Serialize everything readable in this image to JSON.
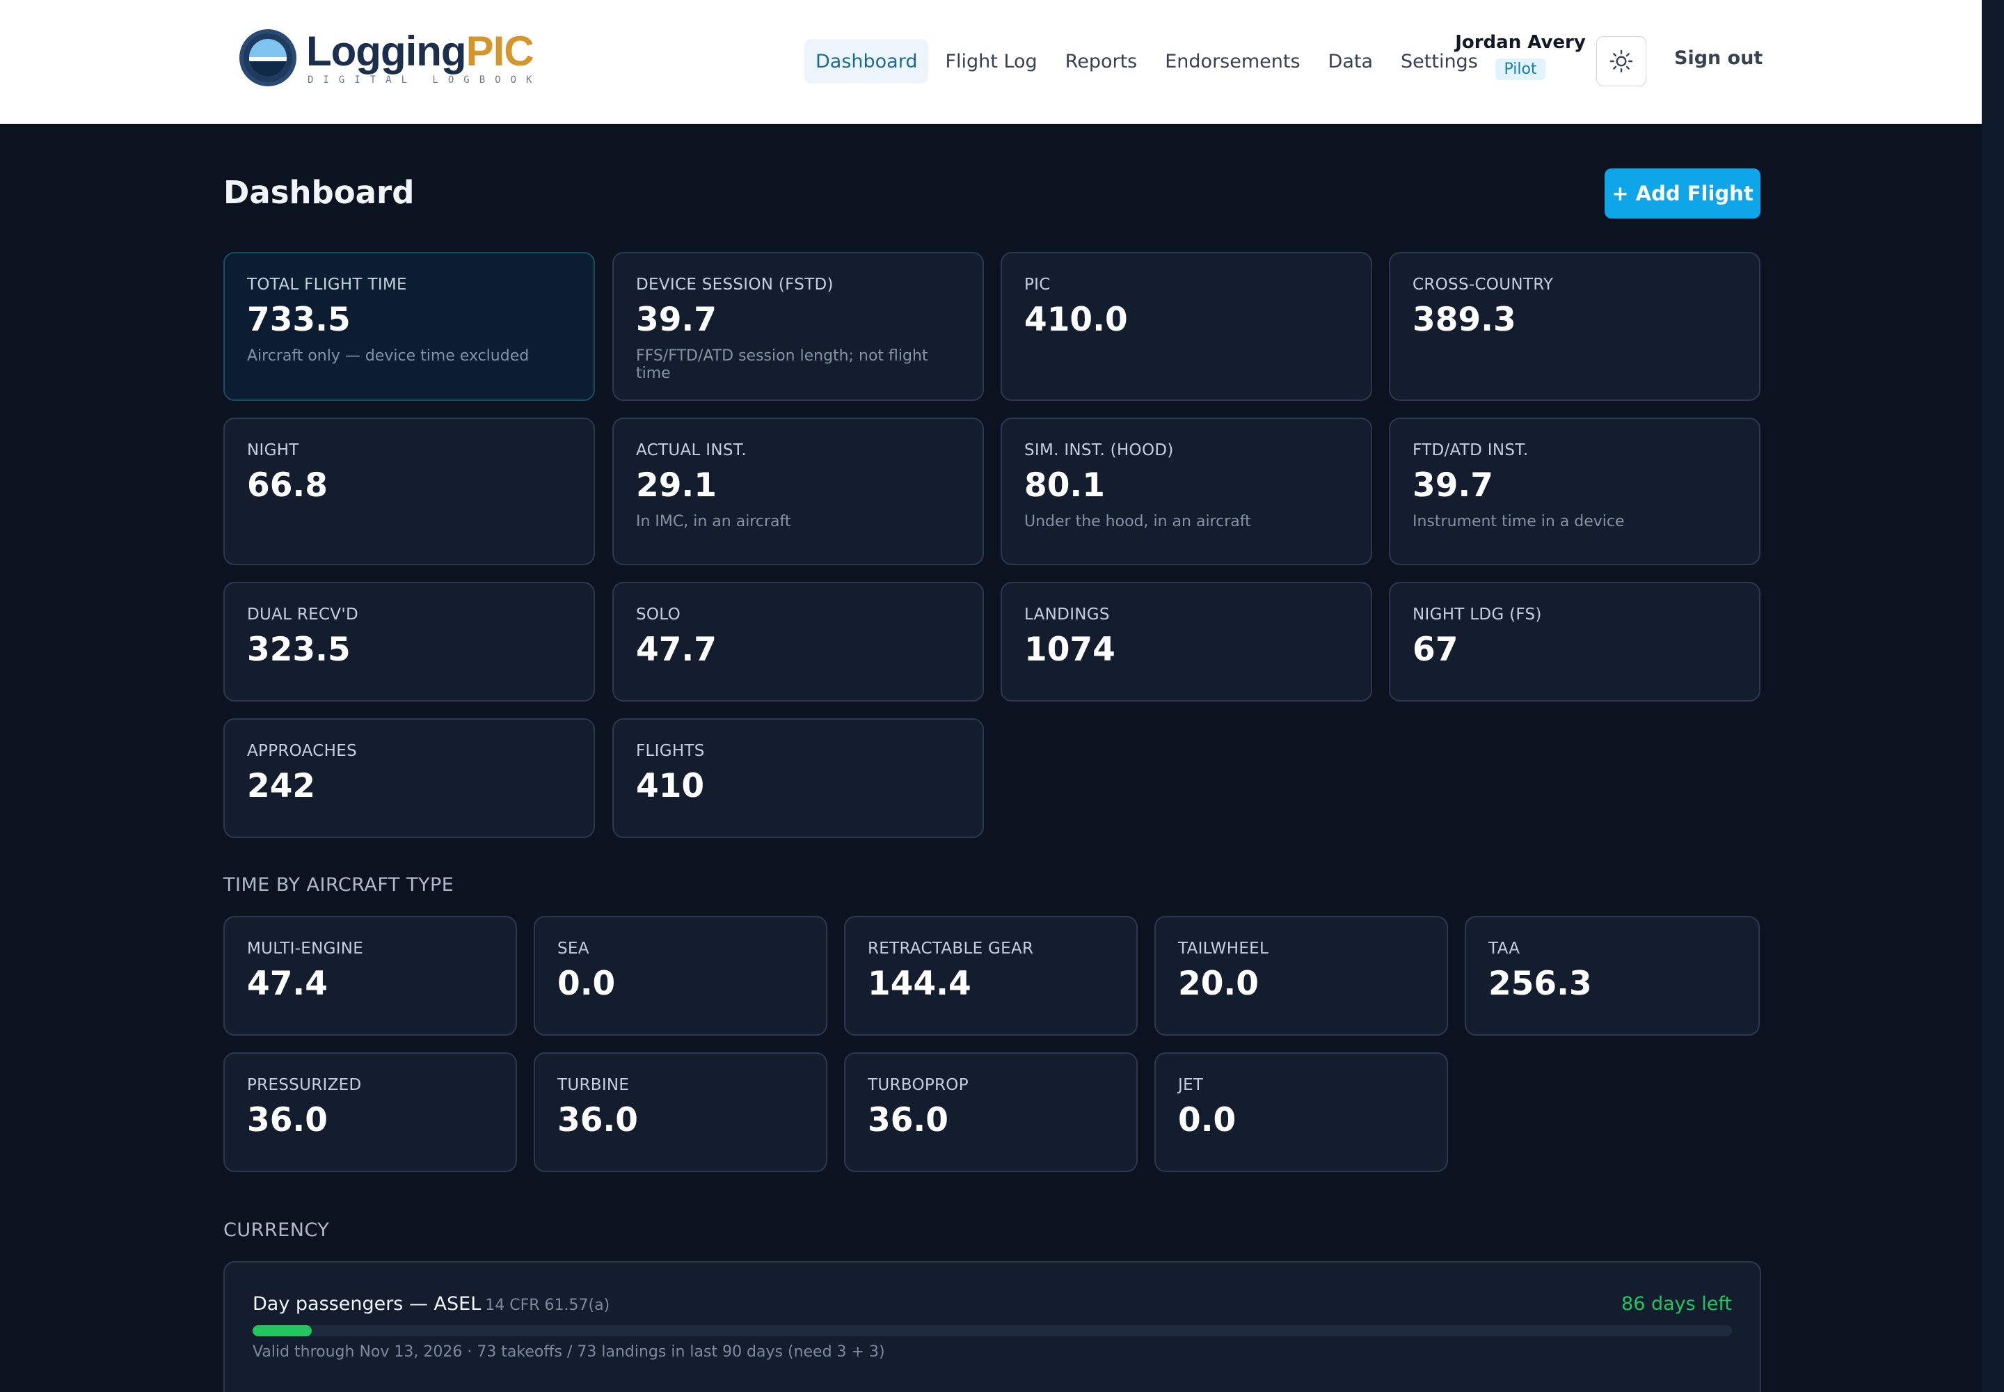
{
  "brand": {
    "word_a": "Logging",
    "word_b": "PIC",
    "tagline": "DIGITAL LOGBOOK"
  },
  "nav": {
    "items": [
      "Dashboard",
      "Flight Log",
      "Reports",
      "Endorsements",
      "Data",
      "Settings"
    ],
    "active": "Dashboard"
  },
  "user": {
    "name": "Jordan Avery",
    "role": "Pilot"
  },
  "header": {
    "theme_icon": "sun-icon",
    "signout": "Sign out"
  },
  "page": {
    "title": "Dashboard",
    "add_flight": "+ Add Flight"
  },
  "totals": [
    {
      "label": "TOTAL FLIGHT TIME",
      "value": "733.5",
      "sub": "Aircraft only — device time excluded"
    },
    {
      "label": "DEVICE SESSION (FSTD)",
      "value": "39.7",
      "sub": "FFS/FTD/ATD session length; not flight time"
    },
    {
      "label": "PIC",
      "value": "410.0",
      "sub": ""
    },
    {
      "label": "CROSS-COUNTRY",
      "value": "389.3",
      "sub": ""
    },
    {
      "label": "NIGHT",
      "value": "66.8",
      "sub": ""
    },
    {
      "label": "ACTUAL INST.",
      "value": "29.1",
      "sub": "In IMC, in an aircraft"
    },
    {
      "label": "SIM. INST. (HOOD)",
      "value": "80.1",
      "sub": "Under the hood, in an aircraft"
    },
    {
      "label": "FTD/ATD INST.",
      "value": "39.7",
      "sub": "Instrument time in a device"
    },
    {
      "label": "DUAL RECV'D",
      "value": "323.5",
      "sub": ""
    },
    {
      "label": "SOLO",
      "value": "47.7",
      "sub": ""
    },
    {
      "label": "LANDINGS",
      "value": "1074",
      "sub": ""
    },
    {
      "label": "NIGHT LDG (FS)",
      "value": "67",
      "sub": ""
    },
    {
      "label": "APPROACHES",
      "value": "242",
      "sub": ""
    },
    {
      "label": "FLIGHTS",
      "value": "410",
      "sub": ""
    }
  ],
  "aircraft_type": {
    "title": "TIME BY AIRCRAFT TYPE",
    "cards": [
      {
        "label": "MULTI-ENGINE",
        "value": "47.4"
      },
      {
        "label": "SEA",
        "value": "0.0"
      },
      {
        "label": "RETRACTABLE GEAR",
        "value": "144.4"
      },
      {
        "label": "TAILWHEEL",
        "value": "20.0"
      },
      {
        "label": "TAA",
        "value": "256.3"
      },
      {
        "label": "PRESSURIZED",
        "value": "36.0"
      },
      {
        "label": "TURBINE",
        "value": "36.0"
      },
      {
        "label": "TURBOPROP",
        "value": "36.0"
      },
      {
        "label": "JET",
        "value": "0.0"
      }
    ]
  },
  "currency": {
    "title": "CURRENCY",
    "items": [
      {
        "name": "Day passengers — ASEL",
        "cfr": "14 CFR 61.57(a)",
        "days_left": "86 days left",
        "progress": 0.04,
        "note": "Valid through Nov 13, 2026 · 73 takeoffs / 73 landings in last 90 days (need 3 + 3)",
        "status_color": "#22c55e"
      }
    ]
  }
}
